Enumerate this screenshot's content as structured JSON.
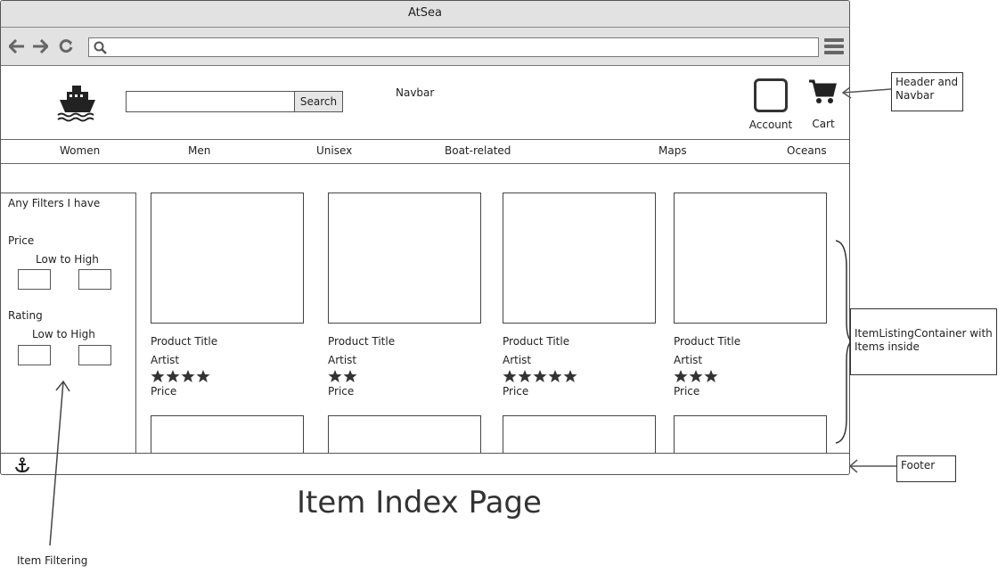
{
  "window": {
    "title": "AtSea"
  },
  "header": {
    "search_button": "Search",
    "navbar_note": "Navbar",
    "account_label": "Account",
    "cart_label": "Cart"
  },
  "categories": [
    "Women",
    "Men",
    "Unisex",
    "Boat-related",
    "Maps",
    "Oceans"
  ],
  "filters": {
    "heading": "Any Filters I have",
    "price_label": "Price",
    "price_range_label": "Low to High",
    "rating_label": "Rating",
    "rating_range_label": "Low to High"
  },
  "products": [
    {
      "title": "Product Title",
      "artist": "Artist",
      "rating": 4,
      "price": "Price"
    },
    {
      "title": "Product Title",
      "artist": "Artist",
      "rating": 2,
      "price": "Price"
    },
    {
      "title": "Product Title",
      "artist": "Artist",
      "rating": 5,
      "price": "Price"
    },
    {
      "title": "Product Title",
      "artist": "Artist",
      "rating": 3,
      "price": "Price"
    }
  ],
  "annotations": {
    "header_navbar": "Header and Navbar",
    "item_listing": "ItemListingContainer with Items inside",
    "footer": "Footer",
    "item_filtering": "Item Filtering",
    "page_title": "Item Index Page"
  },
  "icons": {
    "logo": "ship-icon",
    "footer": "anchor-icon",
    "cart": "cart-icon",
    "account": "account-icon"
  }
}
